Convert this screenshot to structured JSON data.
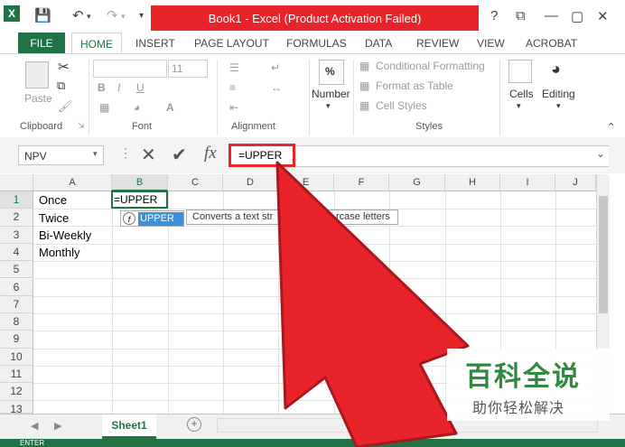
{
  "title_bar": {
    "window_title": "Book1 - Excel (Product Activation Failed)",
    "help": "?",
    "restore": "⧉",
    "minimize": "—",
    "maximize": "▢",
    "close": "✕"
  },
  "tabs": [
    "FILE",
    "HOME",
    "INSERT",
    "PAGE LAYOUT",
    "FORMULAS",
    "DATA",
    "REVIEW",
    "VIEW",
    "ACROBAT"
  ],
  "ribbon": {
    "clipboard": {
      "label": "Clipboard",
      "paste": "Paste"
    },
    "font": {
      "label": "Font",
      "size": "11",
      "bold": "B",
      "italic": "I",
      "underline": "U"
    },
    "alignment": {
      "label": "Alignment"
    },
    "number": {
      "label": "Number",
      "percent": "%"
    },
    "styles": {
      "label": "Styles",
      "conditional_formatting": "Conditional Formatting",
      "format_as_table": "Format as Table",
      "cell_styles": "Cell Styles"
    },
    "cells": {
      "label": "Cells"
    },
    "editing": {
      "label": "Editing"
    }
  },
  "formula_bar": {
    "name_box": "NPV",
    "cancel": "✕",
    "enter": "✔",
    "fx": "fx",
    "content": "=UPPER"
  },
  "grid": {
    "columns": [
      "A",
      "B",
      "C",
      "D",
      "E",
      "F",
      "G",
      "H",
      "I",
      "J"
    ],
    "rows": [
      "1",
      "2",
      "3",
      "4",
      "5",
      "6",
      "7",
      "8",
      "9",
      "10",
      "11",
      "12",
      "13"
    ],
    "cells": {
      "A1": "Once",
      "A2": "Twice",
      "A3": "Bi-Weekly",
      "A4": "Monthly",
      "B1": "=UPPER"
    }
  },
  "autocomplete": {
    "suggestion": "UPPER",
    "tooltip_left": "Converts a text str",
    "tooltip_right": "rcase letters"
  },
  "sheet_tabs": {
    "active": "Sheet1",
    "add": "+"
  },
  "status": {
    "mode": "ENTER"
  },
  "watermark": {
    "main": "百科全说",
    "sub": "助你轻松解决"
  },
  "colors": {
    "excel_green": "#217346",
    "annotation_red": "#e8242a"
  }
}
